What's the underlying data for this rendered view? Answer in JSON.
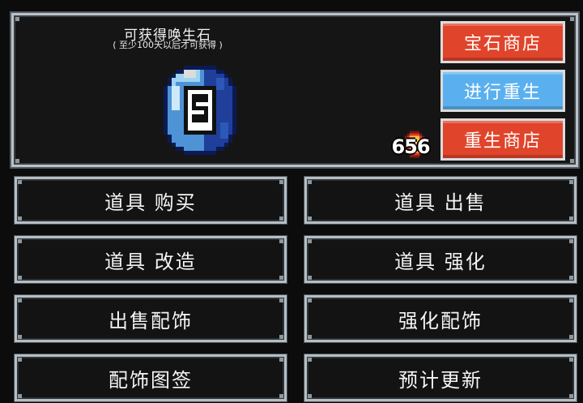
{
  "header": {
    "title": "可获得唤生石",
    "subtitle": "( 至少100天以后才可获得 )"
  },
  "currency": {
    "value": "656",
    "icon": "coin-icon"
  },
  "gem": {
    "icon": "gem-icon",
    "glyph": "S",
    "colors": {
      "light": "#9fd3f2",
      "mid": "#4d93d6",
      "dark": "#1f3f9a",
      "outline": "#0b1a55"
    }
  },
  "side_buttons": {
    "gem_shop": "宝石商店",
    "rebirth": "进行重生",
    "rebirth_shop": "重生商店"
  },
  "menu": {
    "items": [
      {
        "label": "道具 购买"
      },
      {
        "label": "道具 出售"
      },
      {
        "label": "道具 改造"
      },
      {
        "label": "道具 强化"
      },
      {
        "label": "出售配饰"
      },
      {
        "label": "强化配饰"
      },
      {
        "label": "配饰图签"
      },
      {
        "label": "预计更新"
      }
    ]
  },
  "colors": {
    "red_button": "#e0442a",
    "blue_button": "#5ab0ee",
    "frame": "#b9c2c8",
    "panel": "#151515"
  }
}
